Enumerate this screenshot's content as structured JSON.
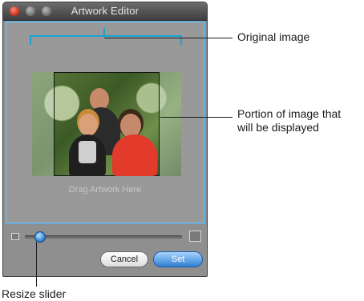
{
  "window": {
    "title": "Artwork Editor",
    "drag_text": "Drag Artwork Here"
  },
  "buttons": {
    "cancel": "Cancel",
    "set": "Set"
  },
  "annotations": {
    "original_image": "Original image",
    "portion_line1": "Portion of image that",
    "portion_line2": "will be displayed",
    "resize_slider": "Resize slider"
  },
  "colors": {
    "accent": "#1ba3d0",
    "set_button": "#2f7fd2",
    "close_button": "#c8261a"
  },
  "slider": {
    "value_fraction": 0.08
  }
}
